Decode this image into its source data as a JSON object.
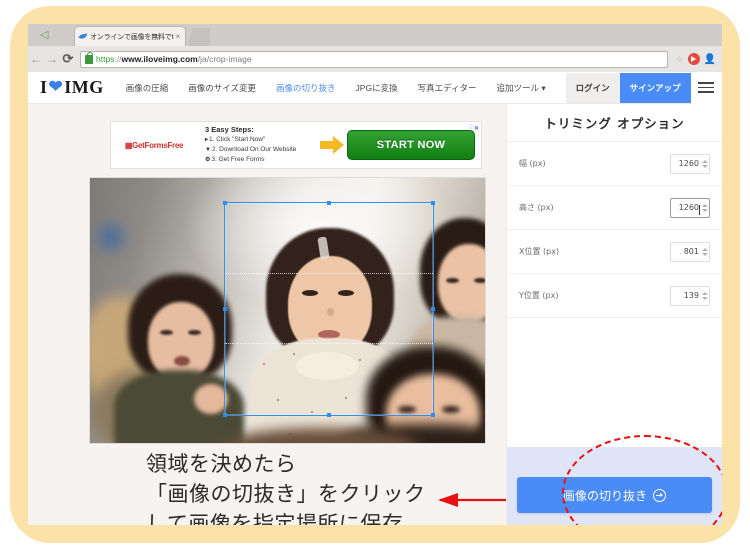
{
  "browser": {
    "tab": {
      "title": "オンラインで画像を無料でt",
      "favicon_icon": "blue-bird-favicon",
      "close_icon": "close-icon"
    },
    "new_tab_icon": "new-tab-icon",
    "nav": {
      "back_icon": "back-arrow-icon",
      "forward_icon": "forward-arrow-icon",
      "reload_icon": "reload-icon"
    },
    "omnibox": {
      "lock_icon": "lock-icon",
      "scheme": "https",
      "separator": "://",
      "host": "www.iloveimg.com",
      "path": "/ja/crop-image",
      "bookmark_icon": "star-icon"
    },
    "record_icon": "record-icon",
    "profile_icon": "profile-icon"
  },
  "site": {
    "logo": {
      "left": "I",
      "heart_icon": "heart-icon",
      "right": "IMG"
    },
    "nav_items": [
      {
        "label": "画像の圧縮",
        "active": false
      },
      {
        "label": "画像のサイズ変更",
        "active": false
      },
      {
        "label": "画像の切り抜き",
        "active": true
      },
      {
        "label": "JPGに変換",
        "active": false
      },
      {
        "label": "写真エディター",
        "active": false
      },
      {
        "label": "追加ツール ▾",
        "active": false
      }
    ],
    "login_label": "ログイン",
    "signup_label": "サインアップ",
    "menu_icon": "hamburger-menu-icon",
    "accent_color": "#4a8cf7"
  },
  "ad": {
    "brand": "GetFormsFree",
    "heading": "3 Easy Steps:",
    "steps": [
      "1. Click \"Start Now\"",
      "2. Download On Our Website",
      "3. Get Free Forms"
    ],
    "arrow_icon": "yellow-arrow-icon",
    "cta_label": "START NOW",
    "adchoices_icon": "adchoices-icon",
    "close_icon": "ad-close-icon"
  },
  "editor": {
    "photo_alt": "blurred photo of kindergarten children at a table",
    "crop_selection": {
      "handle_icon": "resize-handle",
      "guide_lines": 2
    }
  },
  "annotation": {
    "lines": [
      "領域を決めたら",
      "「画像の切抜き」をクリック",
      "して画像を指定場所に保存"
    ],
    "arrow_icon": "red-left-arrow-icon",
    "highlight_icon": "red-dashed-ellipse",
    "highlight_color": "#e81010"
  },
  "panel": {
    "title": "トリミング オプション",
    "fields": [
      {
        "label": "幅 (px)",
        "value": "1260",
        "focused": false,
        "stepper_icon": "spinner-arrows-icon"
      },
      {
        "label": "高さ (px)",
        "value": "1260",
        "focused": true,
        "stepper_icon": "spinner-arrows-icon"
      },
      {
        "label": "X位置 (px)",
        "value": "801",
        "focused": false,
        "stepper_icon": "spinner-arrows-icon"
      },
      {
        "label": "Y位置 (px)",
        "value": "139",
        "focused": false,
        "stepper_icon": "spinner-arrows-icon"
      }
    ],
    "action_button": {
      "label": "画像の切り抜き",
      "icon": "arrow-right-circle-icon"
    }
  }
}
